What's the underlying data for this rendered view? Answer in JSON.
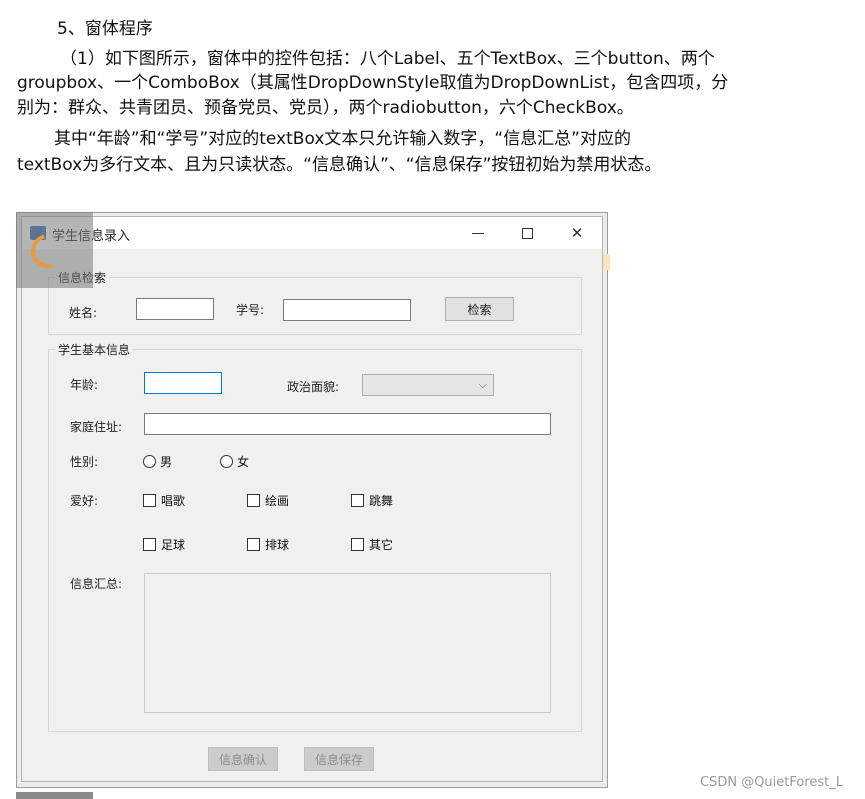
{
  "doc": {
    "heading": "5、窗体程序",
    "paragraph1": [
      "（1）如下图所示，窗体中的控件包括：八个Label、五个TextBox、三个button、两个",
      "groupbox、一个ComboBox（其属性DropDownStyle取值为DropDownList，包含四项，分",
      "别为：群众、共青团员、预备党员、党员），两个radiobutton，六个CheckBox。"
    ],
    "paragraph2": [
      "其中“年龄”和“学号”对应的textBox文本只允许输入数字，“信息汇总”对应的",
      "textBox为多行文本、且为只读状态。“信息确认”、“信息保存”按钮初始为禁用状态。"
    ]
  },
  "window": {
    "title": "学生信息录入",
    "search_group": {
      "title": "信息检索",
      "name_label": "姓名:",
      "id_label": "学号:",
      "search_button": "检索"
    },
    "info_group": {
      "title": "学生基本信息",
      "age_label": "年龄:",
      "politics_label": "政治面貌:",
      "address_label": "家庭住址:",
      "gender_label": "性别:",
      "gender_options": [
        "男",
        "女"
      ],
      "hobby_label": "爱好:",
      "hobbies": [
        "唱歌",
        "绘画",
        "跳舞",
        "足球",
        "排球",
        "其它"
      ],
      "summary_label": "信息汇总:"
    },
    "confirm_button": "信息确认",
    "save_button": "信息保存"
  },
  "watermark": "CSDN @QuietForest_L"
}
